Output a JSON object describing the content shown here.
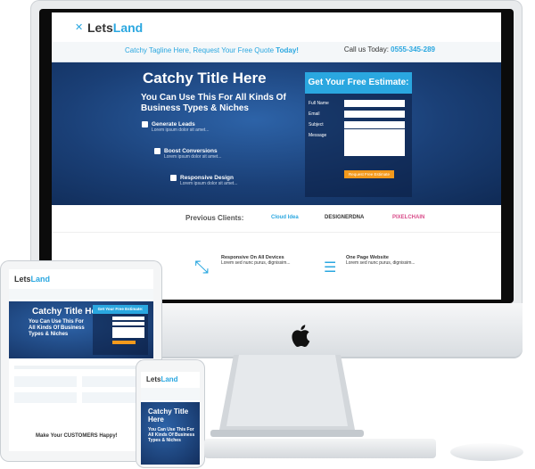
{
  "site": {
    "logo_prefix": "Lets",
    "logo_accent": "Land",
    "tagline": "Catchy Tagline Here, Request Your Free Quote",
    "tagline_emph": "Today!",
    "call_label": "Call us Today:",
    "call_number": "0555-345-289",
    "hero_title": "Catchy Title Here",
    "hero_subtitle": "You Can Use This For All Kinds Of Business Types & Niches",
    "bullets": [
      {
        "heading": "Generate Leads",
        "text": "Lorem ipsum dolor sit amet..."
      },
      {
        "heading": "Boost Conversions",
        "text": "Lorem ipsum dolor sit amet..."
      },
      {
        "heading": "Responsive Design",
        "text": "Lorem ipsum dolor sit amet..."
      }
    ],
    "form_title": "Get Your Free Estimate:",
    "form_fields": [
      "Full Name",
      "Email",
      "Subject",
      "Message"
    ],
    "form_button": "Request Free Estimate",
    "clients_label": "Previous Clients:",
    "clients": [
      "Cloud Idea",
      "DESIGNERDNA",
      "PIXELCHAIN"
    ],
    "feature_1_title": "Responsive On All Devices",
    "feature_1_text": "Lorem sed nunc purus, dignissim...",
    "feature_2_title": "One Page Website",
    "feature_2_text": "Lorem sed nunc purus, dignissim..."
  },
  "tablet": {
    "hero_title": "Catchy Title Here",
    "hero_subtitle": "You Can Use This For All Kinds Of Business Types & Niches",
    "form_title": "Get Your Free Estimate:",
    "footer_cta": "Make Your CUSTOMERS Happy!"
  },
  "phone": {
    "logo_prefix": "Lets",
    "logo_accent": "Land",
    "hero_title": "Catchy Title Here",
    "hero_subtitle": "You Can Use This For All Kinds Of Business Types & Niches"
  },
  "colors": {
    "accent": "#2aa7e0",
    "hero": "#1a3f76",
    "button": "#f49a1c"
  }
}
